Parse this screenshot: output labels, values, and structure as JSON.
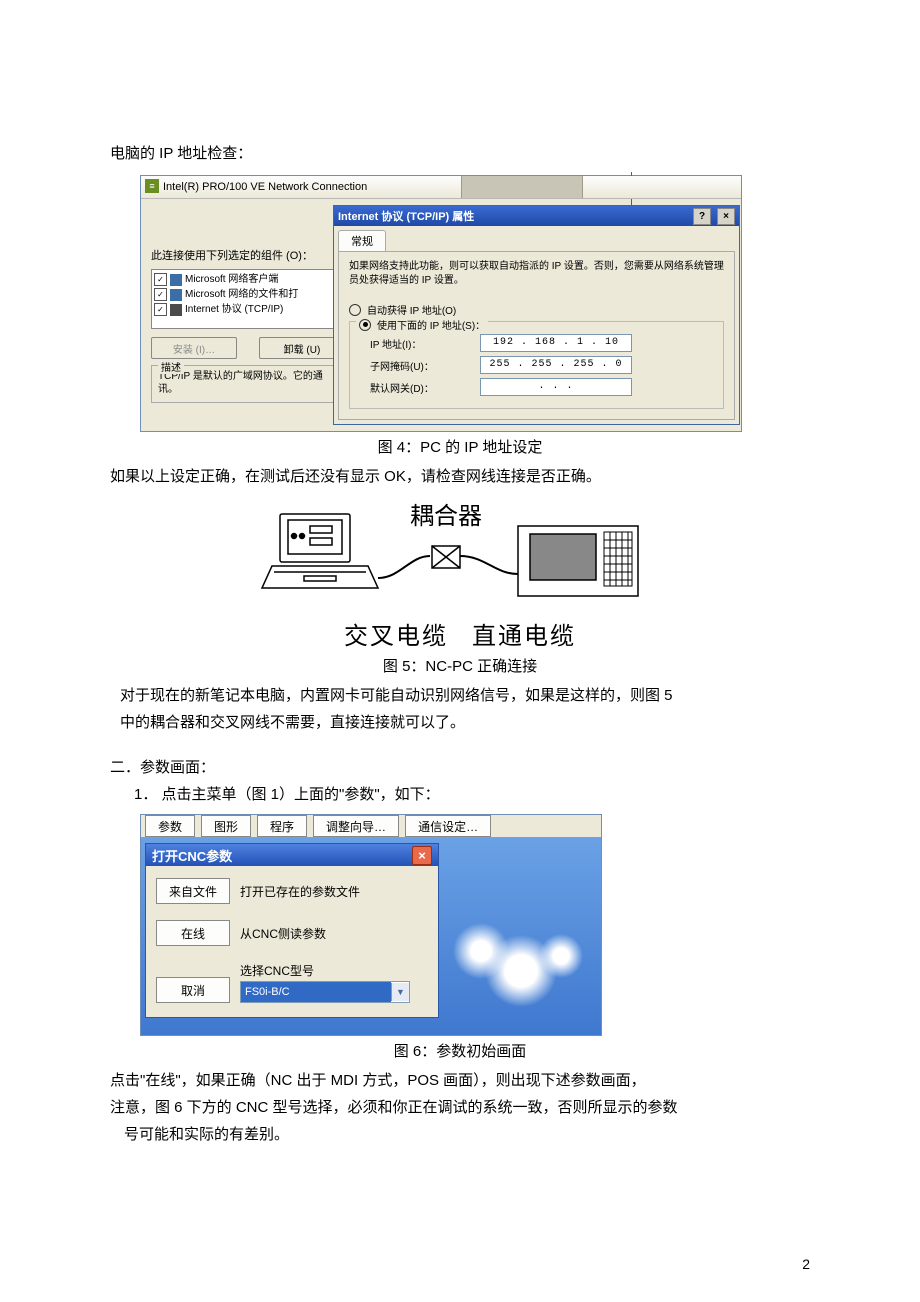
{
  "intro_line": "电脑的 IP 地址检查：",
  "fig4": {
    "outer_title": "Intel(R) PRO/100 VE Network Connection",
    "left": {
      "components_label": "此连接使用下列选定的组件 (O)：",
      "items": [
        "Microsoft 网络客户端",
        "Microsoft 网络的文件和打",
        "Internet 协议 (TCP/IP)"
      ],
      "btn_install": "安装 (I)…",
      "btn_uninstall": "卸载 (U)",
      "desc_legend": "描述",
      "desc_text": "TCP/IP 是默认的广域网协议。它的通讯。"
    },
    "dlg": {
      "title": "Internet 协议 (TCP/IP) 属性",
      "tab": "常规",
      "note": "如果网络支持此功能，则可以获取自动指派的 IP 设置。否则，您需要从网络系统管理员处获得适当的 IP 设置。",
      "radio_auto": "自动获得 IP 地址(O)",
      "radio_manual": "使用下面的 IP 地址(S)：",
      "label_ip": "IP 地址(I)：",
      "label_mask": "子网掩码(U)：",
      "label_gw": "默认网关(D)：",
      "value_ip": "192 . 168 .  1  . 10",
      "value_mask": "255 . 255 . 255 .  0",
      "value_gw": ".       .       ."
    }
  },
  "caption4": "图 4：PC 的 IP 地址设定",
  "after4": "如果以上设定正确，在测试后还没有显示 OK，请检查网线连接是否正确。",
  "fig5": {
    "label_coupler": "耦合器",
    "label_cross": "交叉电缆",
    "label_straight": "直通电缆"
  },
  "caption5": "图 5：NC-PC 正确连接",
  "after5a": "对于现在的新笔记本电脑，内置网卡可能自动识别网络信号，如果是这样的，则图 5",
  "after5b": "中的耦合器和交叉网线不需要，直接连接就可以了。",
  "section2_title": "二．参数画面：",
  "section2_step": "1．  点击主菜单（图 1）上面的\"参数\"，如下：",
  "fig6": {
    "menu": [
      "参数",
      "图形",
      "程序",
      "调整向导…",
      "通信设定…"
    ],
    "dlg_title": "打开CNC参数",
    "rows": [
      {
        "btn": "来自文件",
        "desc": "打开已存在的参数文件"
      },
      {
        "btn": "在线",
        "desc": "从CNC侧读参数"
      }
    ],
    "select_label": "选择CNC型号",
    "cancel": "取消",
    "combo_value": "FS0i-B/C"
  },
  "caption6": "图 6：参数初始画面",
  "after6a": "点击\"在线\"，如果正确（NC 出于 MDI 方式，POS 画面），则出现下述参数画面，",
  "after6b": "注意，图 6 下方的 CNC 型号选择，必须和你正在调试的系统一致，否则所显示的参数",
  "after6c": "号可能和实际的有差别。",
  "page_number": "2"
}
